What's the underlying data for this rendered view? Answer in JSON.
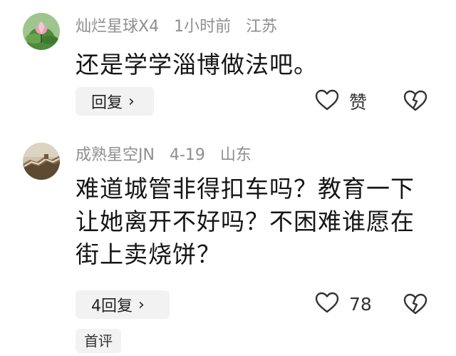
{
  "comments": [
    {
      "avatar_icon": "lotus-avatar-icon",
      "username": "灿烂星球X4",
      "time": "1小时前",
      "location": "江苏",
      "text": "还是学学淄博做法吧。",
      "reply_label": "回复",
      "like_label": "赞",
      "like_icon": "heart-outline-icon",
      "dislike_icon": "broken-heart-icon"
    },
    {
      "avatar_icon": "great-wall-avatar-icon",
      "username": "成熟星空JN",
      "time": "4-19",
      "location": "山东",
      "text": "难道城管非得扣车吗？教育一下让她离开不好吗？不困难谁愿在街上卖烧饼？",
      "reply_label": "4回复",
      "like_label": "78",
      "like_icon": "heart-outline-icon",
      "dislike_icon": "broken-heart-icon",
      "badge": "首评"
    }
  ]
}
